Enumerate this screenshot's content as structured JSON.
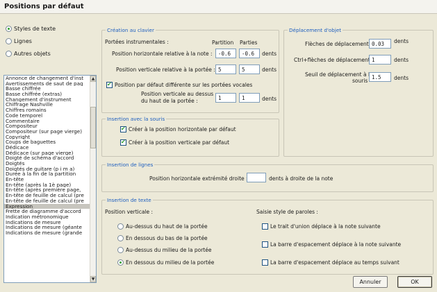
{
  "window": {
    "title": "Positions par défaut"
  },
  "category_radios": [
    {
      "label": "Styles de texte",
      "selected": true
    },
    {
      "label": "Lignes",
      "selected": false
    },
    {
      "label": "Autres objets",
      "selected": false
    }
  ],
  "object_list": {
    "selected": "Expression",
    "items": [
      "Annonce de changement d'inst",
      "Avertissements de saut de pag",
      "Basse chiffrée",
      "Basse chiffrée (extras)",
      "Changement d'instrument",
      "Chiffrage Nashville",
      "Chiffres romains",
      "Code temporel",
      "Commentaire",
      "Compositeur",
      "Compositeur (sur page vierge)",
      "Copyright",
      "Coups de baguettes",
      "Dédicace",
      "Dédicace (sur page vierge)",
      "Doigté de schéma d'accord",
      "Doigtés",
      "Doigtés de guitare (p i m a)",
      "Durée à la fin de la partition",
      "En-tête",
      "En-tête (après la 1è page)",
      "En-tête (après première page,",
      "En-tête de feuille de calcul (pre",
      "En-tête de feuille de calcul (pre",
      "Expression",
      "Frette de diagramme d'accord",
      "Indication métronomique",
      "Indications de mesure",
      "Indications de mesure (géante",
      "Indications de mesure (grande"
    ]
  },
  "creation_clavier": {
    "title": "Création au clavier",
    "staff_label": "Portées instrumentales :",
    "col_partition": "Partition",
    "col_parties": "Parties",
    "h_label": "Position horizontale relative à la note :",
    "h_partition": "-0.6",
    "h_parties": "-0.6",
    "h_unit": "dents",
    "v_label": "Position verticale relative à la portée :",
    "v_partition": "5",
    "v_parties": "5",
    "v_unit": "dents",
    "vocal_check_label": "Position par défaut différente sur les portées vocales",
    "vocal_checked": true,
    "vocal_label_1": "Position verticale au dessus",
    "vocal_label_2": "du haut de la portée :",
    "vocal_partition": "1",
    "vocal_parties": "1",
    "vocal_unit": "dents"
  },
  "deplacement": {
    "title": "Déplacement d'objet",
    "arrows_label": "Flèches de déplacement",
    "arrows_value": "0.03",
    "arrows_unit": "dents",
    "ctrl_label": "Ctrl+flèches de déplacement",
    "ctrl_value": "1",
    "ctrl_unit": "dents",
    "threshold_label_1": "Seuil de déplacement à la",
    "threshold_label_2": "souris",
    "threshold_value": "1.5",
    "threshold_unit": "dents"
  },
  "insertion_souris": {
    "title": "Insertion avec la souris",
    "h_label": "Créer à la position horizontale par défaut",
    "h_checked": true,
    "v_label": "Créer à la position verticale par défaut",
    "v_checked": true
  },
  "insertion_lignes": {
    "title": "Insertion de lignes",
    "label": "Position horizontale extrémité droite :",
    "value": "",
    "suffix": "dents à droite de la note"
  },
  "insertion_texte": {
    "title": "Insertion de texte",
    "vpos_label": "Position verticale :",
    "options": [
      {
        "label": "Au-dessus du haut de la portée",
        "selected": false
      },
      {
        "label": "En dessous du bas de la portée",
        "selected": false
      },
      {
        "label": "Au-dessus du milieu de la portée",
        "selected": false
      },
      {
        "label": "En dessous du milieu de la portée",
        "selected": true
      }
    ],
    "lyrics_label": "Saisie style de paroles :",
    "lyrics_checks": [
      {
        "label": "Le trait d'union déplace à la note suivante",
        "checked": false
      },
      {
        "label": "La barre d'espacement déplace à la note suivante",
        "checked": false
      },
      {
        "label": "La barre d'espacement déplace au temps suivant",
        "checked": false
      }
    ]
  },
  "buttons": {
    "cancel": "Annuler",
    "ok": "OK"
  }
}
